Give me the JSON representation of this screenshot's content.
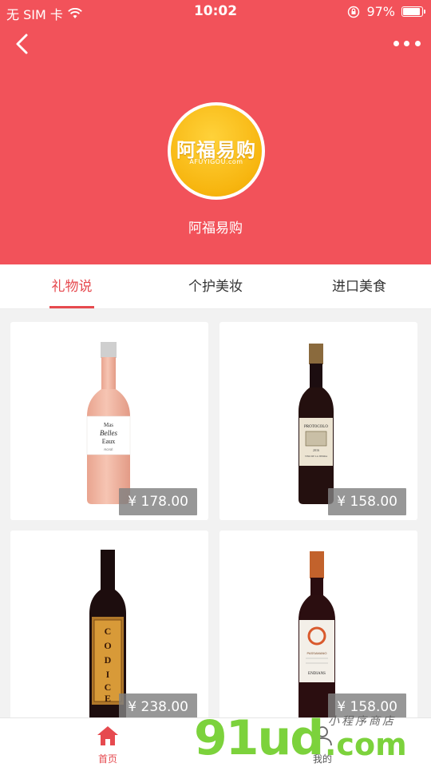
{
  "status_bar": {
    "carrier": "无 SIM 卡",
    "time": "10:02",
    "battery_percent": "97%",
    "battery_level": 0.97
  },
  "nav": {
    "back_icon": "chevron-left-icon",
    "more_icon": "more-dots-icon"
  },
  "shop": {
    "logo_text": "阿福易购",
    "logo_subtext": "AFUYIGOU.com",
    "name": "阿福易购"
  },
  "tabs": [
    {
      "label": "礼物说",
      "active": true
    },
    {
      "label": "个护美妆",
      "active": false
    },
    {
      "label": "进口美食",
      "active": false
    }
  ],
  "products": [
    {
      "price": "¥ 178.00",
      "label_text": "Mas Belles Eaux",
      "kind": "rose-wine"
    },
    {
      "price": "¥ 158.00",
      "label_text": "PROTOCOLO",
      "kind": "red-wine"
    },
    {
      "price": "¥ 238.00",
      "label_text": "CODICE",
      "kind": "red-wine"
    },
    {
      "price": "¥ 158.00",
      "label_text": "ENDIANS",
      "kind": "red-wine"
    }
  ],
  "tabbar": {
    "home_label": "首页",
    "mine_label": "我的",
    "accent_color": "#e64a4f"
  },
  "watermark": {
    "brand": "91ud",
    "domain": ".com",
    "tag": "小程序商店"
  },
  "colors": {
    "header_bg": "#f2525a",
    "accent": "#e64a4f",
    "logo_yellow": "#f7b50f"
  }
}
